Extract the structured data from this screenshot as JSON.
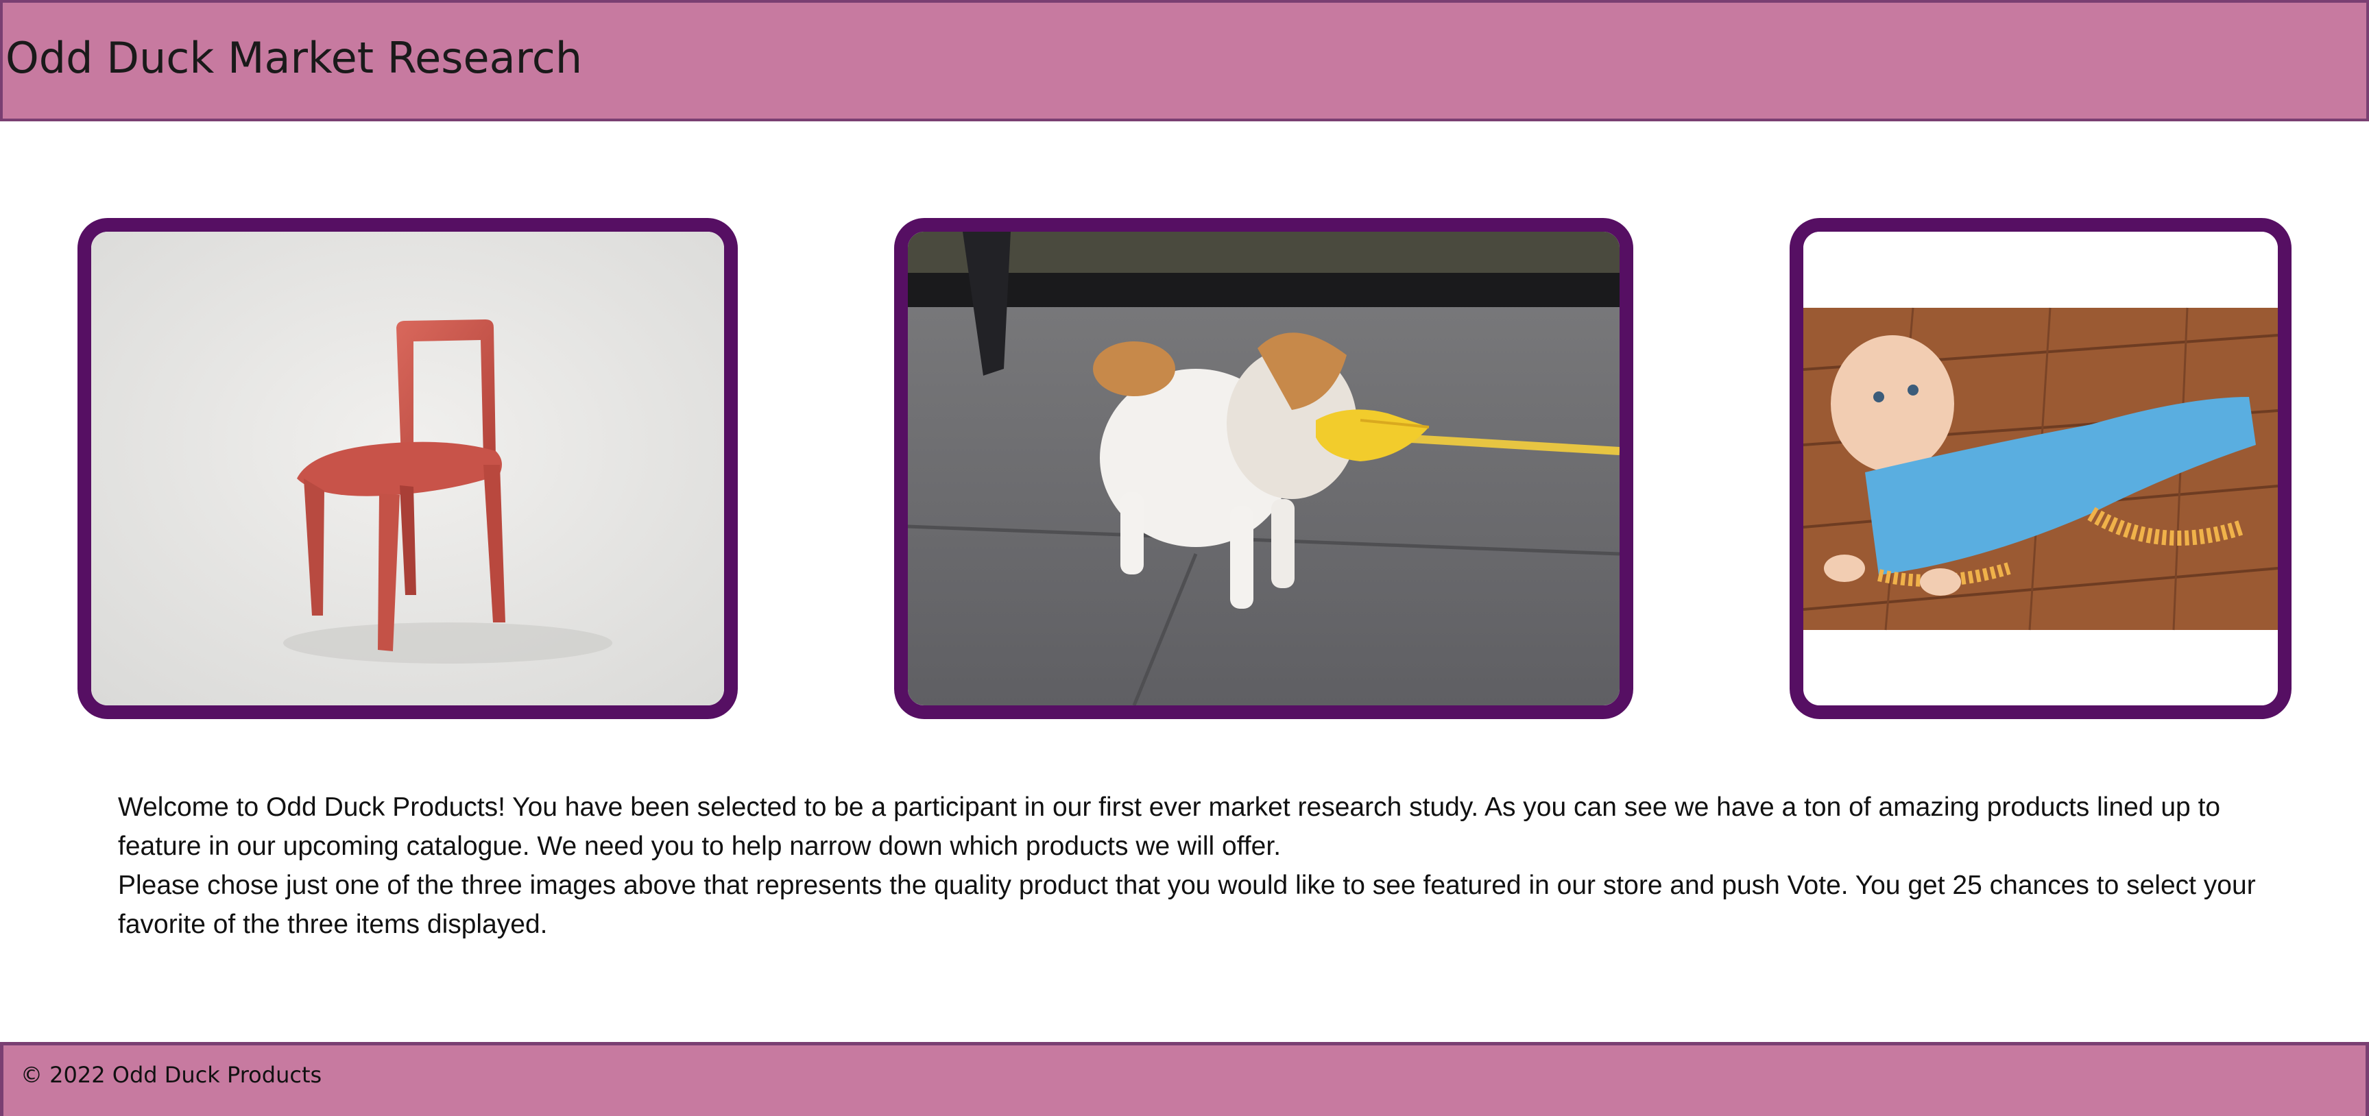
{
  "header": {
    "title": "Odd Duck Market Research"
  },
  "products": [
    {
      "name": "chair"
    },
    {
      "name": "dog-duck"
    },
    {
      "name": "baby-sweep"
    }
  ],
  "intro": {
    "paragraph_1": "Welcome to Odd Duck Products! You have been selected to be a participant in our first ever market research study. As you can see we have a ton of amazing products lined up to feature in our upcoming catalogue. We need you to help narrow down which products we will offer.",
    "paragraph_2": "Please chose just one of the three images above that represents the quality product that you would like to see featured in our store and push Vote. You get 25 chances to select your favorite of the three items displayed."
  },
  "footer": {
    "text": "© 2022 Odd Duck Products"
  },
  "colors": {
    "header_bg": "#c77aa0",
    "header_border": "#7a3f72",
    "card_border": "#560f63"
  }
}
